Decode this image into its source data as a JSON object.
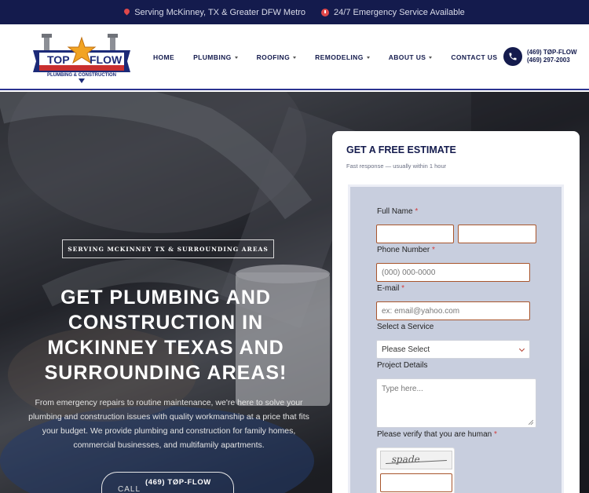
{
  "topbar": {
    "location": "Serving McKinney, TX & Greater DFW Metro",
    "emergency": "24/7 Emergency Service Available"
  },
  "brand": {
    "logo_top": "TOP",
    "logo_flow": "FLOW",
    "logo_tagline": "PLUMBING & CONSTRUCTION"
  },
  "nav": {
    "items": [
      {
        "label": "HOME"
      },
      {
        "label": "PLUMBING"
      },
      {
        "label": "ROOFING"
      },
      {
        "label": "REMODELING"
      },
      {
        "label": "ABOUT US"
      },
      {
        "label": "CONTACT US"
      }
    ],
    "phone_line1": "(469) TØP-FLOW",
    "phone_line2": "(469) 297-2003"
  },
  "hero": {
    "tagline": "SERVING MCKINNEY TX & SURROUNDING AREAS",
    "title": "GET PLUMBING AND CONSTRUCTION IN MCKINNEY TEXAS AND SURROUNDING AREAS!",
    "description": "From emergency repairs to routine maintenance, we're here to solve your plumbing and construction issues with quality workmanship at a price that fits your budget. We provide plumbing and construction for family homes, commercial businesses, and multifamily apartments.",
    "call_label": "CALL",
    "call_number": "(469) TØP-FLOW"
  },
  "form": {
    "title": "GET A FREE ESTIMATE",
    "subtitle": "Fast response — usually within 1 hour",
    "full_name_label": "Full Name",
    "phone_label": "Phone Number",
    "phone_placeholder": "(000) 000-0000",
    "email_label": "E-mail",
    "email_placeholder": "ex: email@yahoo.com",
    "service_label": "Select a Service",
    "service_value": "Please Select",
    "details_label": "Project Details",
    "details_placeholder": "Type here...",
    "verify_label": "Please verify that you are human",
    "captcha_text": "spade",
    "required_mark": "*"
  },
  "colors": {
    "navy": "#141b4d",
    "accent_red": "#e0484a",
    "form_panel": "#c8cede",
    "field_border": "#a8552c"
  }
}
